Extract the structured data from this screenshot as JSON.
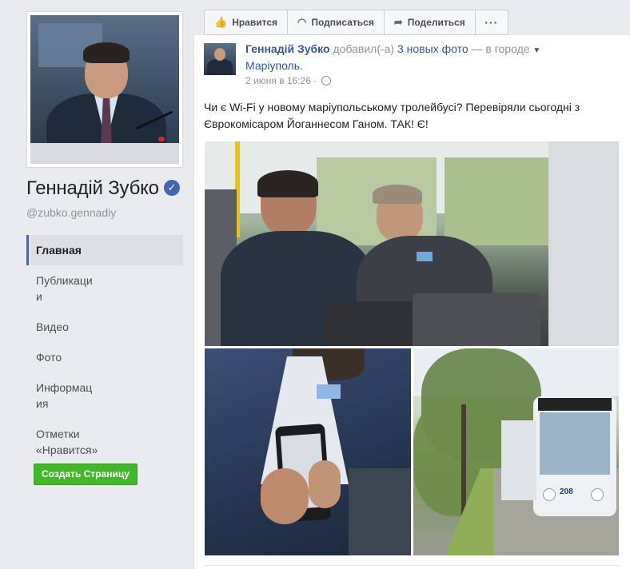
{
  "sidebar": {
    "profile_name": "Геннадій Зубко",
    "handle": "@zubko.gennadiy",
    "nav": [
      {
        "label": "Главная",
        "active": true
      },
      {
        "label": "Публикации",
        "active": false
      },
      {
        "label": "Видео",
        "active": false
      },
      {
        "label": "Фото",
        "active": false
      },
      {
        "label": "Информация",
        "active": false
      },
      {
        "label": "Отметки «Нравится»",
        "active": false
      }
    ],
    "create_page_label": "Создать Страницу"
  },
  "actions": {
    "like_label": "Нравится",
    "subscribe_label": "Подписаться",
    "share_label": "Поделиться",
    "more_label": "···"
  },
  "post": {
    "author": "Геннадій Зубко",
    "added_text": "добавил(-а)",
    "photos_link": "3 новых фото",
    "in_city_text": "— в городе",
    "city": "Маріуполь.",
    "timestamp": "2 июня в 16:26",
    "text": "Чи є Wi-Fi у новому маріупольському тролейбусі? Перевіряли сьогодні з Єврокомісаром Йоганнесом Ганом. ТАК! Є!",
    "bus_number": "208"
  },
  "colors": {
    "link": "#365899",
    "accent": "#4267b2",
    "create_button": "#42b72a"
  },
  "icons": {
    "like": "thumbs-up-icon",
    "subscribe": "rss-icon",
    "share": "share-arrow-icon",
    "verified": "verified-check-icon",
    "privacy": "globe-icon"
  }
}
